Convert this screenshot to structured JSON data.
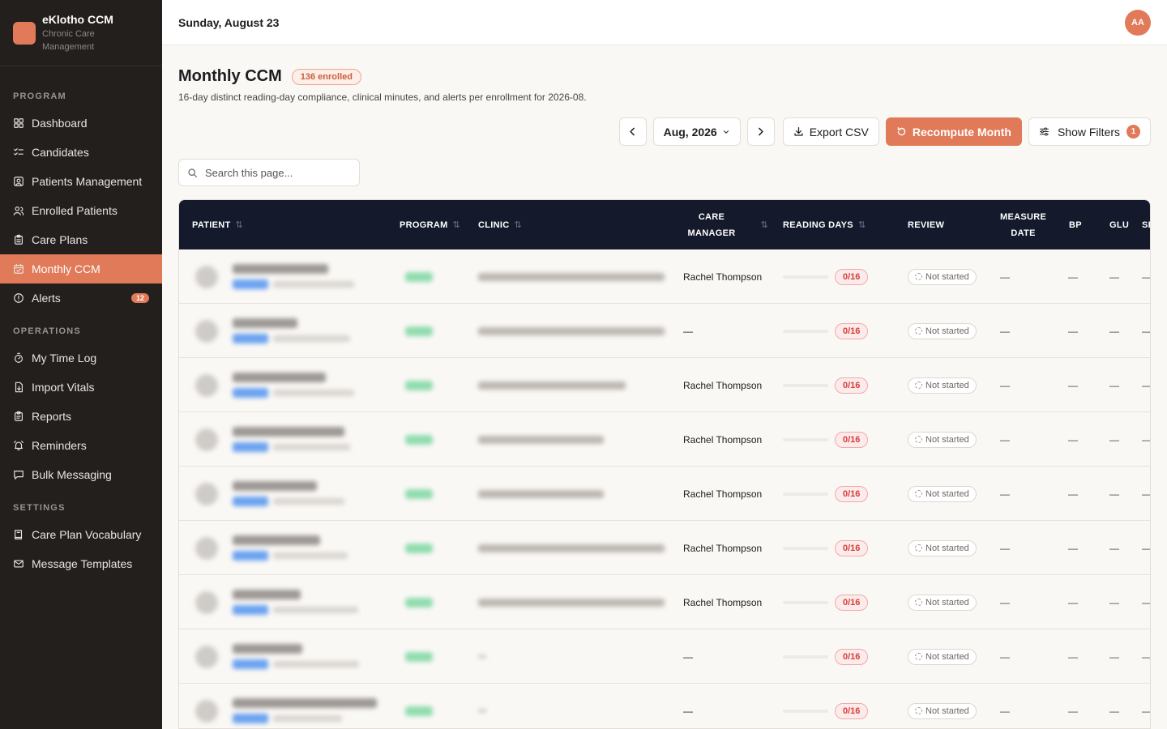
{
  "brand": {
    "title": "eKlotho CCM",
    "subtitle_line1": "Chronic Care",
    "subtitle_line2": "Management",
    "logo_color": "#e07a59"
  },
  "sidebar": {
    "sections": [
      {
        "heading": "PROGRAM",
        "items": [
          {
            "label": "Dashboard",
            "icon": "grid-icon"
          },
          {
            "label": "Candidates",
            "icon": "checklist-icon"
          },
          {
            "label": "Patients Management",
            "icon": "user-square-icon"
          },
          {
            "label": "Enrolled Patients",
            "icon": "users-icon"
          },
          {
            "label": "Care Plans",
            "icon": "clipboard-icon"
          },
          {
            "label": "Monthly CCM",
            "icon": "calendar-check-icon",
            "active": true
          },
          {
            "label": "Alerts",
            "icon": "alert-circle-icon",
            "badge": "12"
          }
        ]
      },
      {
        "heading": "OPERATIONS",
        "items": [
          {
            "label": "My Time Log",
            "icon": "timer-icon"
          },
          {
            "label": "Import Vitals",
            "icon": "file-import-icon"
          },
          {
            "label": "Reports",
            "icon": "clipboard-list-icon"
          },
          {
            "label": "Reminders",
            "icon": "bell-ring-icon"
          },
          {
            "label": "Bulk Messaging",
            "icon": "message-square-icon"
          }
        ]
      },
      {
        "heading": "SETTINGS",
        "items": [
          {
            "label": "Care Plan Vocabulary",
            "icon": "book-icon"
          },
          {
            "label": "Message Templates",
            "icon": "mail-icon"
          }
        ]
      }
    ]
  },
  "topbar": {
    "date": "Sunday, August 23",
    "avatar_initials": "AA"
  },
  "page": {
    "title": "Monthly CCM",
    "enrolled_badge": "136 enrolled",
    "subtitle": "16-day distinct reading-day compliance, clinical minutes, and alerts per enrollment for 2026-08."
  },
  "toolbar": {
    "month_label": "Aug, 2026",
    "export_label": "Export CSV",
    "recompute_label": "Recompute Month",
    "filters_label": "Show Filters",
    "filters_count": "1"
  },
  "search": {
    "placeholder": "Search this page..."
  },
  "table": {
    "columns": [
      {
        "key": "patient",
        "label": "PATIENT",
        "sortable": true
      },
      {
        "key": "program",
        "label": "PROGRAM",
        "sortable": true
      },
      {
        "key": "clinic",
        "label": "CLINIC",
        "sortable": true
      },
      {
        "key": "care_manager",
        "label_line1": "CARE",
        "label_line2": "MANAGER",
        "sortable": true
      },
      {
        "key": "reading_days",
        "label": "READING DAYS",
        "sortable": true
      },
      {
        "key": "review",
        "label": "REVIEW",
        "sortable": false
      },
      {
        "key": "measure_date",
        "label_line1": "MEASURE",
        "label_line2": "DATE",
        "sortable": false
      },
      {
        "key": "bp",
        "label": "BP",
        "sortable": false
      },
      {
        "key": "glu",
        "label": "GLU",
        "sortable": false
      },
      {
        "key": "more",
        "label": "SI",
        "sortable": false
      }
    ],
    "rows": [
      {
        "care_manager": "Rachel Thompson",
        "reading_days": "0/16",
        "review": "Not started",
        "measure_date": "—",
        "bp": "—",
        "glu": "—",
        "more": "—",
        "clinic_blur": true
      },
      {
        "care_manager": "—",
        "reading_days": "0/16",
        "review": "Not started",
        "measure_date": "—",
        "bp": "—",
        "glu": "—",
        "more": "—",
        "clinic_blur": true
      },
      {
        "care_manager": "Rachel Thompson",
        "reading_days": "0/16",
        "review": "Not started",
        "measure_date": "—",
        "bp": "—",
        "glu": "—",
        "more": "—",
        "clinic_blur": true
      },
      {
        "care_manager": "Rachel Thompson",
        "reading_days": "0/16",
        "review": "Not started",
        "measure_date": "—",
        "bp": "—",
        "glu": "—",
        "more": "—",
        "clinic_blur": true
      },
      {
        "care_manager": "Rachel Thompson",
        "reading_days": "0/16",
        "review": "Not started",
        "measure_date": "—",
        "bp": "—",
        "glu": "—",
        "more": "—",
        "clinic_blur": true
      },
      {
        "care_manager": "Rachel Thompson",
        "reading_days": "0/16",
        "review": "Not started",
        "measure_date": "—",
        "bp": "—",
        "glu": "—",
        "more": "—",
        "clinic_blur": true
      },
      {
        "care_manager": "Rachel Thompson",
        "reading_days": "0/16",
        "review": "Not started",
        "measure_date": "—",
        "bp": "—",
        "glu": "—",
        "more": "—",
        "clinic_blur": true
      },
      {
        "care_manager": "—",
        "reading_days": "0/16",
        "review": "Not started",
        "measure_date": "—",
        "bp": "—",
        "glu": "—",
        "more": "—",
        "clinic_blur": false
      },
      {
        "care_manager": "—",
        "reading_days": "0/16",
        "review": "Not started",
        "measure_date": "—",
        "bp": "—",
        "glu": "—",
        "more": "—",
        "clinic_blur": false
      }
    ]
  },
  "colors": {
    "accent": "#e07a59",
    "header_bg": "#141a2b",
    "sidebar_bg": "#231f1d",
    "danger": "#d43f3a"
  }
}
